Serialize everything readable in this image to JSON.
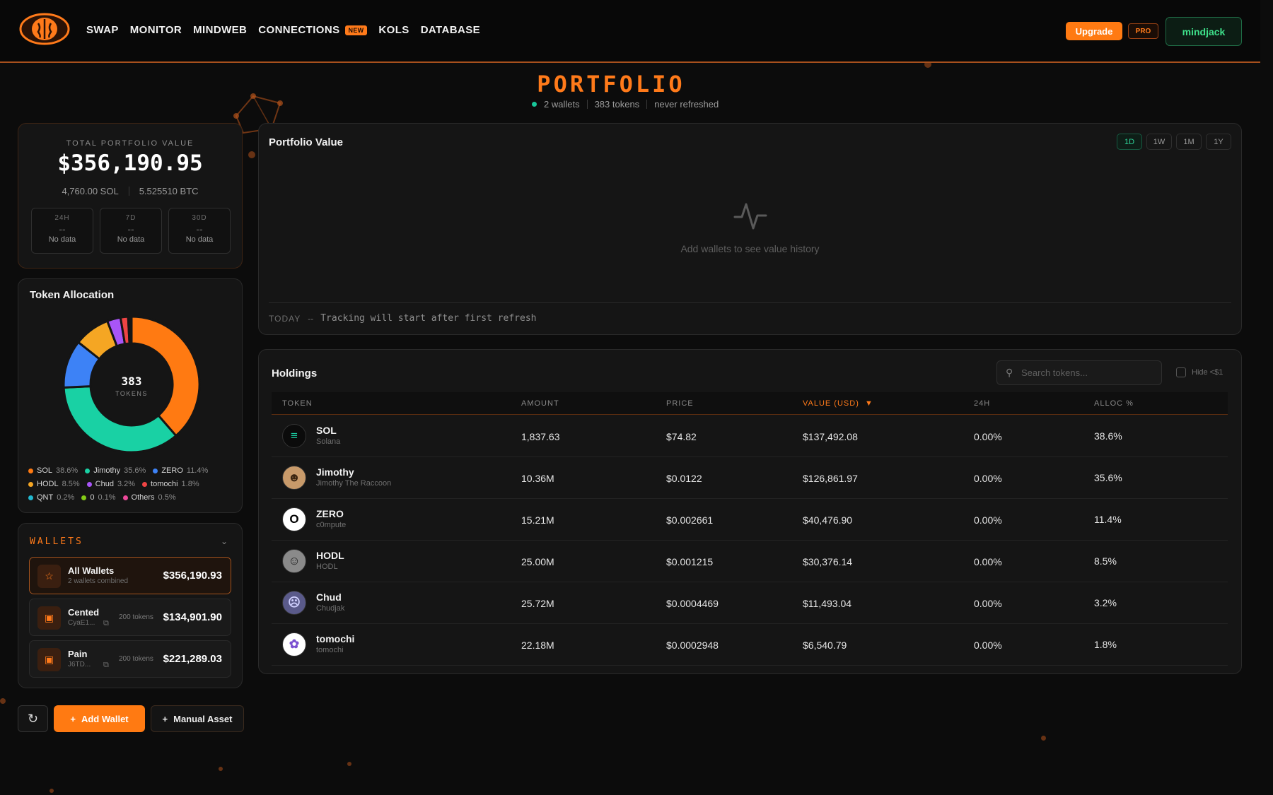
{
  "nav": {
    "items": [
      {
        "label": "SWAP"
      },
      {
        "label": "MONITOR"
      },
      {
        "label": "MINDWEB"
      },
      {
        "label": "CONNECTIONS",
        "badge": "NEW"
      },
      {
        "label": "KOLS"
      },
      {
        "label": "DATABASE"
      }
    ],
    "upgrade": "Upgrade",
    "pro": "PRO",
    "user": "mindjack"
  },
  "header": {
    "title": "PORTFOLIO",
    "wallets": "2 wallets",
    "tokens": "383 tokens",
    "refreshed": "never refreshed"
  },
  "total": {
    "label": "TOTAL PORTFOLIO VALUE",
    "value": "$356,190.95",
    "sol": "4,760.00 SOL",
    "btc": "5.525510 BTC",
    "periods": [
      {
        "label": "24H",
        "value": "--",
        "note": "No data"
      },
      {
        "label": "7D",
        "value": "--",
        "note": "No data"
      },
      {
        "label": "30D",
        "value": "--",
        "note": "No data"
      }
    ]
  },
  "allocation": {
    "title": "Token Allocation",
    "center_count": "383",
    "center_label": "TOKENS",
    "items": [
      {
        "name": "SOL",
        "pct": "38.6%",
        "value": 38.6,
        "color": "#ff7a12"
      },
      {
        "name": "Jimothy",
        "pct": "35.6%",
        "value": 35.6,
        "color": "#19d1a4"
      },
      {
        "name": "ZERO",
        "pct": "11.4%",
        "value": 11.4,
        "color": "#3d82f6"
      },
      {
        "name": "HODL",
        "pct": "8.5%",
        "value": 8.5,
        "color": "#f5a623"
      },
      {
        "name": "Chud",
        "pct": "3.2%",
        "value": 3.2,
        "color": "#a855f7"
      },
      {
        "name": "tomochi",
        "pct": "1.8%",
        "value": 1.8,
        "color": "#ef4444"
      },
      {
        "name": "QNT",
        "pct": "0.2%",
        "value": 0.2,
        "color": "#22b8cf"
      },
      {
        "name": "0",
        "pct": "0.1%",
        "value": 0.1,
        "color": "#84cc16"
      },
      {
        "name": "Others",
        "pct": "0.5%",
        "value": 0.5,
        "color": "#ec4899"
      }
    ]
  },
  "wallets": {
    "title": "WALLETS",
    "rows": [
      {
        "name": "All Wallets",
        "sub": "2 wallets combined",
        "tokens": "",
        "value": "$356,190.93"
      },
      {
        "name": "Cented",
        "sub": "CyaE1...",
        "tokens": "200 tokens",
        "value": "$134,901.90"
      },
      {
        "name": "Pain",
        "sub": "J6TD...",
        "tokens": "200 tokens",
        "value": "$221,289.03"
      }
    ],
    "add_wallet": "Add Wallet",
    "manual_asset": "Manual Asset"
  },
  "value_chart": {
    "title": "Portfolio Value",
    "ranges": [
      "1D",
      "1W",
      "1M",
      "1Y"
    ],
    "active_range": "1D",
    "empty": "Add wallets to see value history",
    "today_label": "TODAY",
    "today_value": "--",
    "tracking_note": "Tracking will start after first refresh"
  },
  "holdings": {
    "title": "Holdings",
    "search_placeholder": "Search tokens...",
    "hide_small": "Hide <$1",
    "columns": [
      "TOKEN",
      "AMOUNT",
      "PRICE",
      "VALUE (USD)",
      "24H",
      "ALLOC %"
    ],
    "sort_indicator": "▼",
    "rows": [
      {
        "symbol": "SOL",
        "name": "Solana",
        "amount": "1,837.63",
        "price": "$74.82",
        "value": "$137,492.08",
        "change": "0.00%",
        "alloc": "38.6%"
      },
      {
        "symbol": "Jimothy",
        "name": "Jimothy The Raccoon",
        "amount": "10.36M",
        "price": "$0.0122",
        "value": "$126,861.97",
        "change": "0.00%",
        "alloc": "35.6%"
      },
      {
        "symbol": "ZERO",
        "name": "c0mpute",
        "amount": "15.21M",
        "price": "$0.002661",
        "value": "$40,476.90",
        "change": "0.00%",
        "alloc": "11.4%"
      },
      {
        "symbol": "HODL",
        "name": "HODL",
        "amount": "25.00M",
        "price": "$0.001215",
        "value": "$30,376.14",
        "change": "0.00%",
        "alloc": "8.5%"
      },
      {
        "symbol": "Chud",
        "name": "Chudjak",
        "amount": "25.72M",
        "price": "$0.0004469",
        "value": "$11,493.04",
        "change": "0.00%",
        "alloc": "3.2%"
      },
      {
        "symbol": "tomochi",
        "name": "tomochi",
        "amount": "22.18M",
        "price": "$0.0002948",
        "value": "$6,540.79",
        "change": "0.00%",
        "alloc": "1.8%"
      }
    ]
  }
}
